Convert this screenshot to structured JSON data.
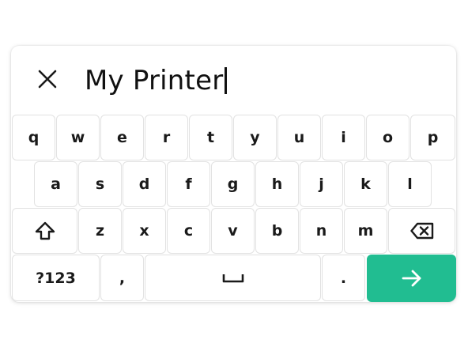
{
  "input": {
    "value": "My Printer"
  },
  "keyboard": {
    "row1": [
      "q",
      "w",
      "e",
      "r",
      "t",
      "y",
      "u",
      "i",
      "o",
      "p"
    ],
    "row2": [
      "a",
      "s",
      "d",
      "f",
      "g",
      "h",
      "j",
      "k",
      "l"
    ],
    "row3": [
      "z",
      "x",
      "c",
      "v",
      "b",
      "n",
      "m"
    ],
    "symbols_label": "?123",
    "comma_label": ",",
    "period_label": "."
  },
  "icons": {
    "close": "close-icon",
    "shift": "shift-icon",
    "backspace": "backspace-icon",
    "space": "space-icon",
    "enter": "arrow-right-icon"
  },
  "colors": {
    "enter_key": "#21bd91",
    "text": "#1a1a1a"
  }
}
